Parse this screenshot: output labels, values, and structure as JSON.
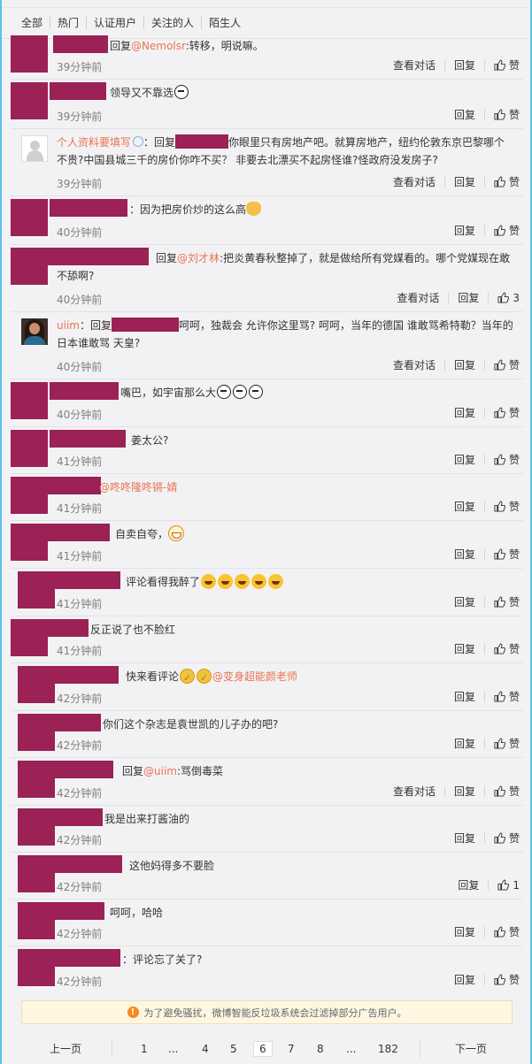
{
  "tabs": [
    "全部",
    "热门",
    "认证用户",
    "关注的人",
    "陌生人"
  ],
  "labels": {
    "reply": "回复",
    "like": "赞",
    "view_conv": "查看对话"
  },
  "comments": [
    {
      "time": "39分钟前",
      "text": "回复",
      "link": "@Nemolsr",
      "text2": ":转移，明说嘛。",
      "conv": true
    },
    {
      "time": "39分钟前",
      "text": "领导又不靠选"
    },
    {
      "time": "39分钟前",
      "user": "个人资料要填写",
      "text": "：回复",
      "text2": "你眼里只有房地产吧。就算房地产，纽约伦敦东京巴黎哪个",
      "line2": "不贵?中国县城三千的房价你咋不买？ 非要去北漂买不起房怪谁?怪政府没发房子?",
      "conv": true
    },
    {
      "time": "40分钟前",
      "text": "：因为把房价炒的这么高"
    },
    {
      "time": "40分钟前",
      "text": "回复",
      "link": "@刘才林",
      "text2": ":把炎黄春秋整掉了，就是做给所有党媒看的。哪个党媒现在敢",
      "line2": "不舔啊?",
      "conv": true,
      "likes": "3"
    },
    {
      "time": "40分钟前",
      "user": "uiim",
      "text": "：回复",
      "text2": "呵呵，独裁会 允许你这里骂? 呵呵，当年的德国 谁敢骂希特勒？当年的",
      "line2": "日本谁敢骂 天皇?",
      "conv": true
    },
    {
      "time": "40分钟前",
      "text": "嘴巴，如宇宙那么大"
    },
    {
      "time": "41分钟前",
      "text": "姜太公?"
    },
    {
      "time": "41分钟前",
      "link": "@咚咚隆咚锵-婧"
    },
    {
      "time": "41分钟前",
      "text": "自卖自夸，"
    },
    {
      "time": "41分钟前",
      "text": "评论看得我醉了"
    },
    {
      "time": "41分钟前",
      "text": "反正说了也不脸红"
    },
    {
      "time": "42分钟前",
      "text": "快来看评论",
      "link": "@变身超能颜老师"
    },
    {
      "time": "42分钟前",
      "text": "你们这个杂志是袁世凯的儿子办的吧?"
    },
    {
      "time": "42分钟前",
      "text": "回复",
      "link": "@uiim",
      "text2": ":骂倒毒菜",
      "conv": true
    },
    {
      "time": "42分钟前",
      "text": "我是出来打酱油的"
    },
    {
      "time": "42分钟前",
      "text": "这他妈得多不要脸",
      "likes": "1"
    },
    {
      "time": "42分钟前",
      "text": "呵呵，哈哈"
    },
    {
      "time": "42分钟前",
      "text": "：评论忘了关了?"
    }
  ],
  "notice": "为了避免骚扰，微博智能反垃圾系统会过滤掉部分广告用户。",
  "pager": {
    "prev": "上一页",
    "next": "下一页",
    "pages": [
      "1",
      "...",
      "4",
      "5",
      "6",
      "7",
      "8",
      "...",
      "182"
    ],
    "current": "6"
  },
  "colors": {
    "redaction": "#9b2156",
    "link": "#eb7350",
    "time": "#808080"
  }
}
